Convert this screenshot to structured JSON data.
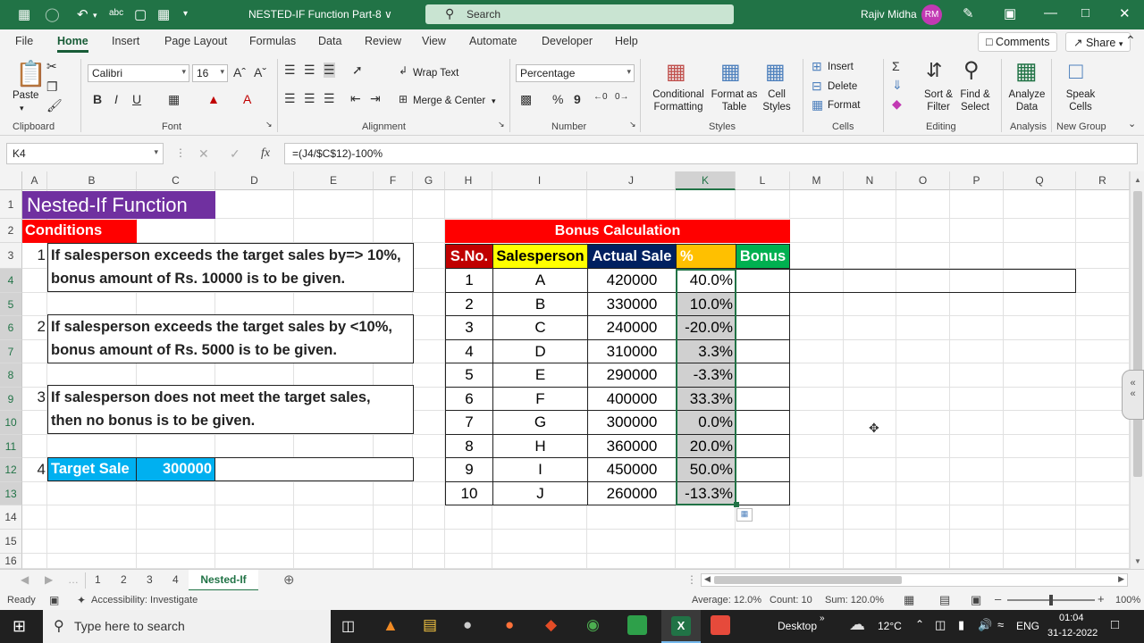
{
  "titlebar": {
    "doc_title": "NESTED-IF Function Part-8 ∨",
    "search_placeholder": "Search",
    "user_name": "Rajiv Midha",
    "user_initials": "RM"
  },
  "tabs": [
    "File",
    "Home",
    "Insert",
    "Page Layout",
    "Formulas",
    "Data",
    "Review",
    "View",
    "Automate",
    "Developer",
    "Help"
  ],
  "active_tab": "Home",
  "comments_label": "Comments",
  "share_label": "Share",
  "ribbon": {
    "paste": "Paste",
    "font_name": "Calibri",
    "font_size": "16",
    "wrap_text": "Wrap Text",
    "merge_center": "Merge & Center",
    "number_format": "Percentage",
    "conditional_formatting": "Conditional Formatting",
    "format_as_table": "Format as Table",
    "cell_styles": "Cell Styles",
    "insert": "Insert",
    "delete": "Delete",
    "format": "Format",
    "sort_filter": "Sort & Filter",
    "find_select": "Find & Select",
    "analyze_data": "Analyze Data",
    "speak_cells": "Speak Cells",
    "groups": [
      "Clipboard",
      "Font",
      "Alignment",
      "Number",
      "Styles",
      "Cells",
      "Editing",
      "Analysis",
      "New Group"
    ]
  },
  "formula_bar": {
    "name_box": "K4",
    "formula": "=(J4/$C$12)-100%"
  },
  "columns": [
    "A",
    "B",
    "C",
    "D",
    "E",
    "F",
    "G",
    "H",
    "I",
    "J",
    "K",
    "L",
    "M",
    "N",
    "O",
    "P",
    "Q",
    "R"
  ],
  "rows": [
    "1",
    "2",
    "3",
    "4",
    "5",
    "6",
    "7",
    "8",
    "9",
    "10",
    "11",
    "12",
    "13",
    "14",
    "15",
    "16"
  ],
  "sheet": {
    "title": "Nested-If Function",
    "conditions_label": "Conditions",
    "condition1_num": "1",
    "condition1_line1": "If salesperson exceeds the target sales by=> 10%,",
    "condition1_line2": "bonus amount of Rs. 10000 is to be given.",
    "condition2_num": "2",
    "condition2_line1": "If salesperson exceeds the target sales by <10%,",
    "condition2_line2": "bonus amount of Rs. 5000 is to be given.",
    "condition3_num": "3",
    "condition3_line1": "If salesperson does not meet the target sales,",
    "condition3_line2": "then no bonus is to be given.",
    "condition4_num": "4",
    "target_label": "Target Sale",
    "target_value": "300000",
    "bonus_title": "Bonus Calculation",
    "headers": [
      "S.No.",
      "Salesperson",
      "Actual Sale",
      "%",
      "Bonus"
    ],
    "table": [
      {
        "sno": "1",
        "name": "A",
        "sale": "420000",
        "pct": "40.0%"
      },
      {
        "sno": "2",
        "name": "B",
        "sale": "330000",
        "pct": "10.0%"
      },
      {
        "sno": "3",
        "name": "C",
        "sale": "240000",
        "pct": "-20.0%"
      },
      {
        "sno": "4",
        "name": "D",
        "sale": "310000",
        "pct": "3.3%"
      },
      {
        "sno": "5",
        "name": "E",
        "sale": "290000",
        "pct": "-3.3%"
      },
      {
        "sno": "6",
        "name": "F",
        "sale": "400000",
        "pct": "33.3%"
      },
      {
        "sno": "7",
        "name": "G",
        "sale": "300000",
        "pct": "0.0%"
      },
      {
        "sno": "8",
        "name": "H",
        "sale": "360000",
        "pct": "20.0%"
      },
      {
        "sno": "9",
        "name": "I",
        "sale": "450000",
        "pct": "50.0%"
      },
      {
        "sno": "10",
        "name": "J",
        "sale": "260000",
        "pct": "-13.3%"
      }
    ]
  },
  "sheet_tabs": [
    "1",
    "2",
    "3",
    "4",
    "Nested-If"
  ],
  "active_sheet": "Nested-If",
  "status": {
    "ready": "Ready",
    "accessibility": "Accessibility: Investigate",
    "average": "Average: 12.0%",
    "count": "Count: 10",
    "sum": "Sum: 120.0%",
    "zoom": "100%"
  },
  "taskbar": {
    "search_placeholder": "Type here to search",
    "desktop": "Desktop",
    "temperature": "12°C",
    "lang": "ENG",
    "time": "01:04",
    "date": "31-12-2022"
  },
  "colors": {
    "excel_green": "#217346",
    "purple": "#7030a0",
    "red": "#ff0000",
    "cyan": "#00b0f0",
    "yellow": "#ffff00",
    "navy": "#002060",
    "orange": "#ffc000",
    "green": "#00b050",
    "selection_gray": "#d0d0d0"
  }
}
